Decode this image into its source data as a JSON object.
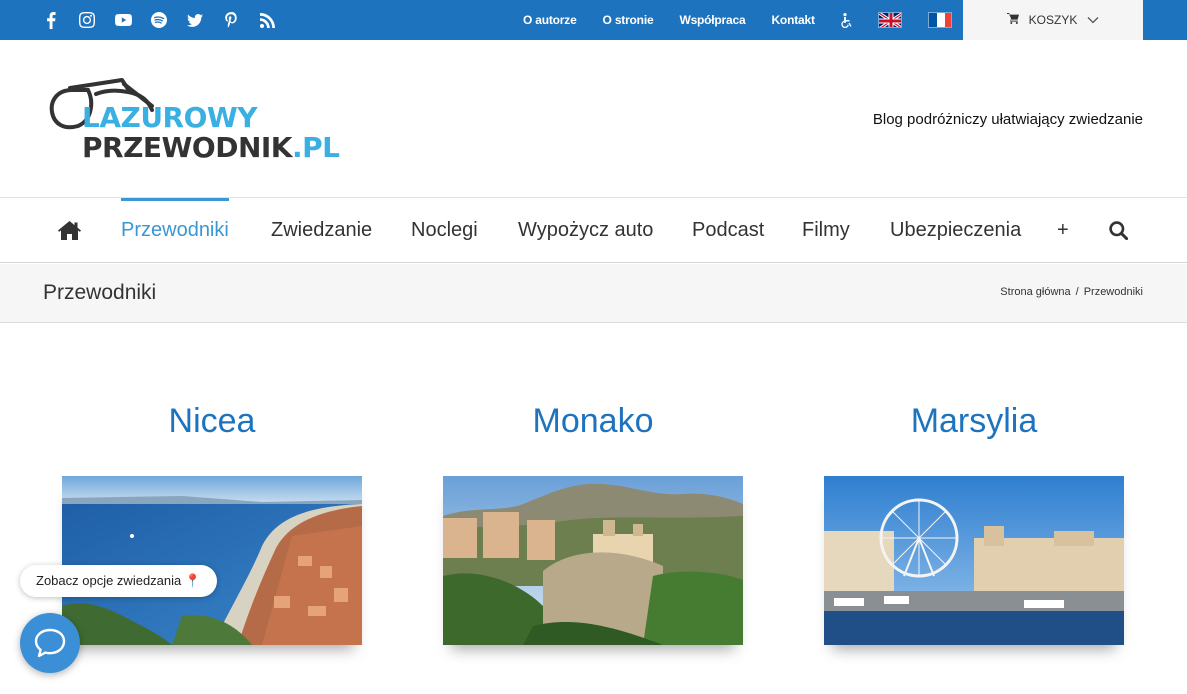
{
  "topbar": {
    "social_icons": [
      "facebook-icon",
      "instagram-icon",
      "youtube-icon",
      "spotify-icon",
      "twitter-icon",
      "pinterest-icon",
      "rss-icon"
    ],
    "links": [
      "O autorze",
      "O stronie",
      "Współpraca",
      "Kontakt"
    ],
    "accessibility_icon": "wheelchair-icon",
    "languages": [
      "en",
      "fr"
    ],
    "cart_label": "KOSZYK",
    "bg_color": "#1e73be"
  },
  "header": {
    "logo_line1": "LAZUROWY",
    "logo_line2": "PRZEWODNIK",
    "logo_tld": ".PL",
    "tagline": "Blog podróżniczy ułatwiający zwiedzanie"
  },
  "mainnav": {
    "items": [
      "Przewodniki",
      "Zwiedzanie",
      "Noclegi",
      "Wypożycz auto",
      "Podcast",
      "Filmy",
      "Ubezpieczenia",
      "+"
    ],
    "active": "Przewodniki",
    "accent": "#3a97d4"
  },
  "titlebar": {
    "title": "Przewodniki",
    "breadcrumb": [
      "Strona główna",
      "Przewodniki"
    ],
    "separator": "/"
  },
  "cards": [
    {
      "title": "Nicea"
    },
    {
      "title": "Monako"
    },
    {
      "title": "Marsylia"
    }
  ],
  "widget": {
    "chip_text": "Zobacz opcje zwiedzania 📍",
    "chat_icon": "chat-bubble-icon"
  }
}
